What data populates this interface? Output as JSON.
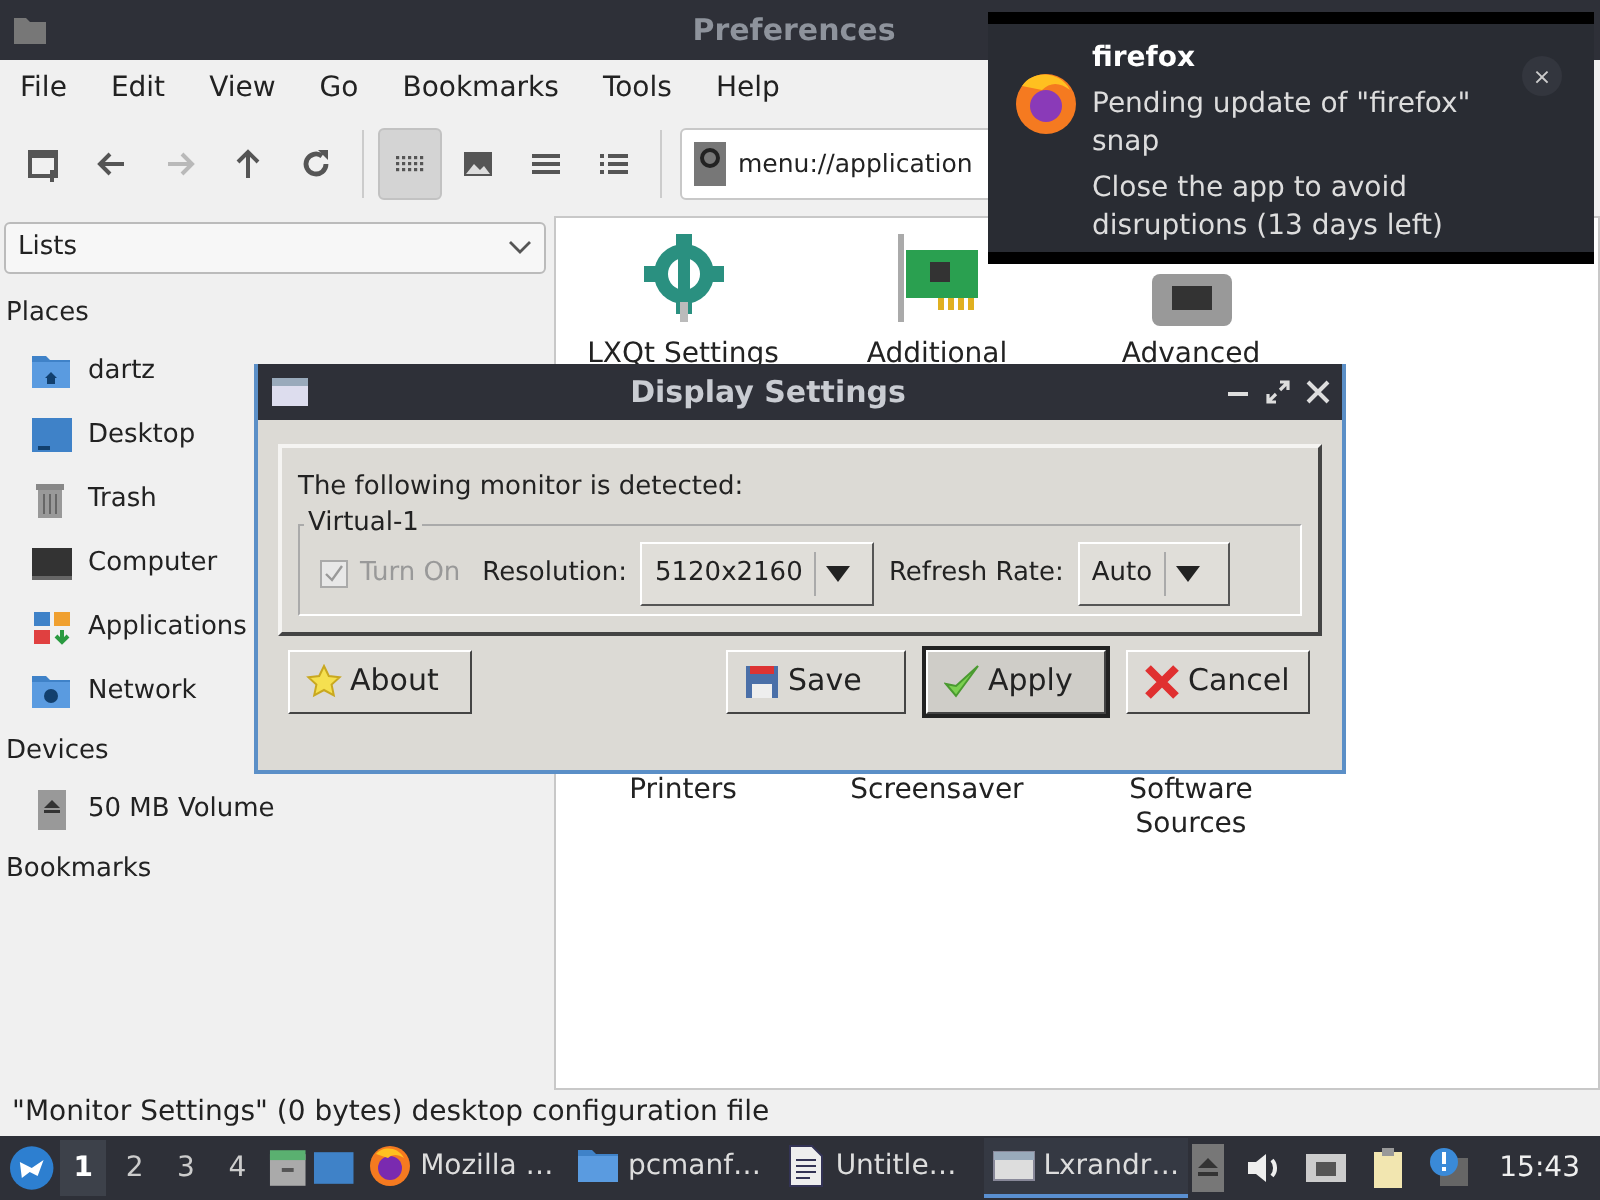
{
  "window": {
    "title": "Preferences"
  },
  "menu": [
    "File",
    "Edit",
    "View",
    "Go",
    "Bookmarks",
    "Tools",
    "Help"
  ],
  "toolbar": [
    {
      "kind": "new-tab",
      "disabled": false,
      "selected": false
    },
    {
      "kind": "back",
      "disabled": false,
      "selected": false
    },
    {
      "kind": "forward",
      "disabled": true,
      "selected": false
    },
    {
      "kind": "up",
      "disabled": false,
      "selected": false
    },
    {
      "kind": "reload",
      "disabled": false,
      "selected": false
    },
    {
      "kind": "icon-view",
      "disabled": false,
      "selected": true
    },
    {
      "kind": "thumbnail-view",
      "disabled": false,
      "selected": false
    },
    {
      "kind": "compact-view",
      "disabled": false,
      "selected": false
    },
    {
      "kind": "detail-view",
      "disabled": false,
      "selected": false
    }
  ],
  "address": {
    "value": "menu://application"
  },
  "sidebar": {
    "mode": "Lists",
    "sections": [
      {
        "title": "Places",
        "items": [
          {
            "label": "dartz",
            "kind": "home"
          },
          {
            "label": "Desktop",
            "kind": "desktop"
          },
          {
            "label": "Trash",
            "kind": "trash"
          },
          {
            "label": "Computer",
            "kind": "computer"
          },
          {
            "label": "Applications",
            "kind": "apps"
          },
          {
            "label": "Network",
            "kind": "network"
          }
        ]
      },
      {
        "title": "Devices",
        "items": [
          {
            "label": "50 MB Volume",
            "kind": "volume"
          }
        ]
      },
      {
        "title": "Bookmarks"
      }
    ]
  },
  "files": [
    {
      "label": "LXQt Settings",
      "kind": "settings"
    },
    {
      "label": "Additional",
      "kind": "card"
    },
    {
      "label": "Advanced",
      "kind": "generic"
    },
    {
      "label": "Printers",
      "kind": "hidden"
    },
    {
      "label": "Screensaver",
      "kind": "hidden"
    },
    {
      "label": "Software\nSources",
      "kind": "hidden"
    }
  ],
  "status_bar": "\"Monitor Settings\" (0 bytes) desktop configuration file",
  "taskbar": {
    "workspaces": [
      {
        "label": "1",
        "selected": true
      },
      {
        "label": "2",
        "selected": false
      },
      {
        "label": "3",
        "selected": false
      },
      {
        "label": "4",
        "selected": false
      }
    ],
    "tasks": [
      {
        "label": "Mozilla …",
        "kind": "firefox",
        "selected": false
      },
      {
        "label": "pcmanf…",
        "kind": "folder",
        "selected": false
      },
      {
        "label": "Untitle…",
        "kind": "document",
        "selected": false
      },
      {
        "label": "Lxrandr…",
        "kind": "window",
        "selected": true
      }
    ],
    "clock": "15:43"
  },
  "dialog": {
    "title": "Display Settings",
    "message": "The following monitor is detected:",
    "group": "Virtual-1",
    "turn_on": {
      "label": "Turn On",
      "checked": true,
      "disabled": true
    },
    "resolution_label": "Resolution:",
    "resolution": "5120x2160",
    "refresh_label": "Refresh Rate:",
    "refresh": "Auto",
    "buttons": [
      {
        "label": "About",
        "kind": "about",
        "focused": false
      },
      {
        "label": "Save",
        "kind": "save",
        "focused": false
      },
      {
        "label": "Apply",
        "kind": "apply",
        "focused": true
      },
      {
        "label": "Cancel",
        "kind": "cancel",
        "focused": false
      }
    ]
  },
  "notification": {
    "app": "firefox",
    "close": "×",
    "lines": [
      "Pending update of \"firefox\" snap",
      "Close the app to avoid disruptions (13 days left)"
    ]
  }
}
